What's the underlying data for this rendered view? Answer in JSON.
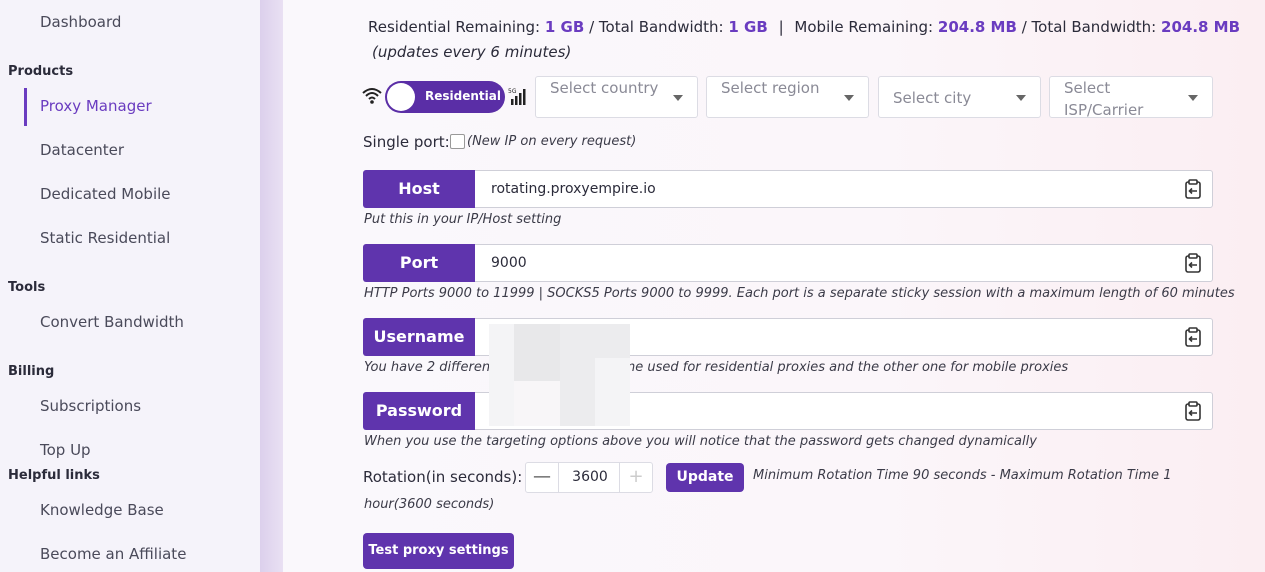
{
  "sidebar": {
    "dashboard": "Dashboard",
    "sections": {
      "products": "Products",
      "tools": "Tools",
      "billing": "Billing",
      "helpful": "Helpful links"
    },
    "items": {
      "proxy_manager": "Proxy Manager",
      "datacenter": "Datacenter",
      "dedicated_mobile": "Dedicated Mobile",
      "static_residential": "Static Residential",
      "convert_bandwidth": "Convert Bandwidth",
      "subscriptions": "Subscriptions",
      "top_up": "Top Up",
      "knowledge_base": "Knowledge Base",
      "affiliate": "Become an Affiliate"
    }
  },
  "usage": {
    "res_label": "Residential Remaining:",
    "res_value": "1 GB",
    "total_label_1": "/ Total Bandwidth:",
    "total_value_1": "1 GB",
    "sep": "|",
    "mob_label": "Mobile Remaining:",
    "mob_value": "204.8 MB",
    "total_label_2": "/ Total Bandwidth:",
    "total_value_2": "204.8 MB",
    "update_note": "(updates every 6 minutes)"
  },
  "filters": {
    "toggle_label": "Residential",
    "country": "Select country",
    "region": "Select region",
    "city": "Select city",
    "isp": "Select ISP/Carrier"
  },
  "single_port": {
    "label": "Single port:",
    "note": "(New IP on every request)"
  },
  "fields": {
    "host": {
      "label": "Host",
      "value": "rotating.proxyempire.io",
      "help": "Put this in your IP/Host setting"
    },
    "port": {
      "label": "Port",
      "value": "9000",
      "help": "HTTP Ports 9000 to 11999 | SOCKS5 Ports 9000 to 9999. Each port is a separate sticky session with a maximum length of 60 minutes"
    },
    "username": {
      "label": "Username",
      "value": "",
      "help_a": "You have 2 different",
      "help_b": "ne used for residential proxies and the other one for mobile proxies"
    },
    "password": {
      "label": "Password",
      "value": "",
      "help": "When you use the targeting options above you will notice that the password gets changed dynamically"
    }
  },
  "rotation": {
    "label": "Rotation(in seconds):",
    "value": "3600",
    "minus": "—",
    "plus": "+",
    "update": "Update",
    "note_1": "Minimum Rotation Time 90 seconds - Maximum Rotation Time 1",
    "note_2": "hour(3600 seconds)"
  },
  "test_button": "Test proxy settings",
  "colors": {
    "accent": "#5f34ad",
    "accent_text": "#6a3cc0"
  }
}
